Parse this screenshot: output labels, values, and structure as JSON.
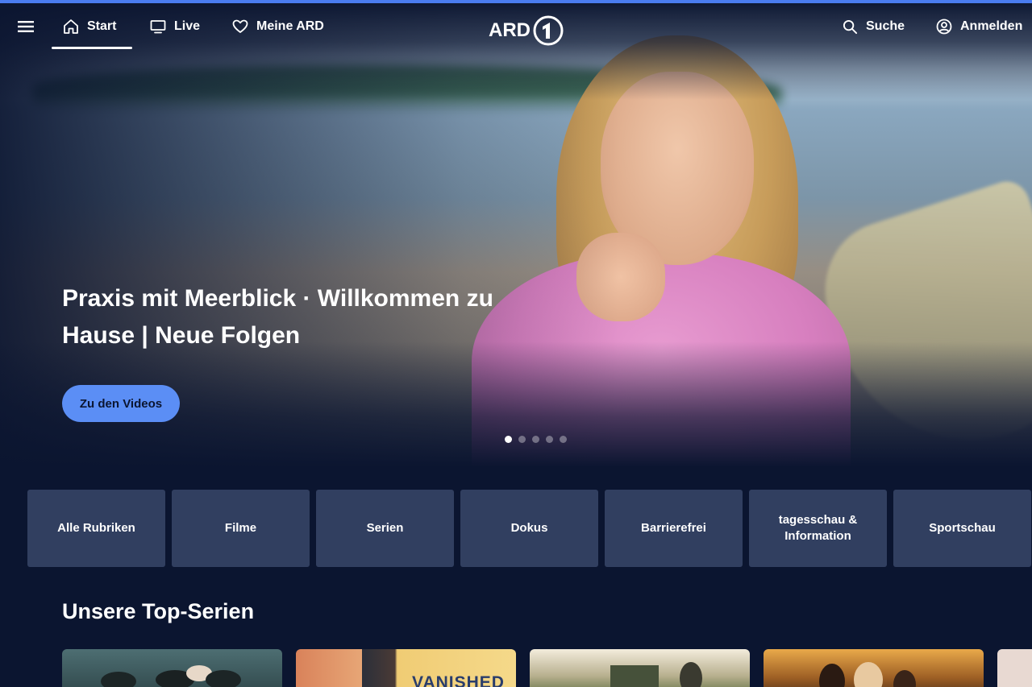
{
  "nav": {
    "menu_icon": "menu-icon",
    "items": [
      {
        "label": "Start",
        "icon": "home-icon",
        "active": true
      },
      {
        "label": "Live",
        "icon": "tv-icon",
        "active": false
      },
      {
        "label": "Meine ARD",
        "icon": "heart-icon",
        "active": false
      }
    ],
    "logo_text": "ARD",
    "logo_badge": "1",
    "search_label": "Suche",
    "login_label": "Anmelden"
  },
  "hero": {
    "title": "Praxis mit Meerblick · Willkommen zu Hause | Neue Folgen",
    "button_label": "Zu den Videos",
    "slides_total": 5,
    "slide_active": 1
  },
  "categories": [
    "Alle Rubriken",
    "Filme",
    "Serien",
    "Dokus",
    "Barrierefrei",
    "tagesschau & Information",
    "Sportschau"
  ],
  "section": {
    "title": "Unsere Top-Serien",
    "card_2_text": "VANISHED"
  },
  "colors": {
    "background": "#0b1530",
    "accent": "#5b8ef5",
    "tile": "#313f60"
  }
}
